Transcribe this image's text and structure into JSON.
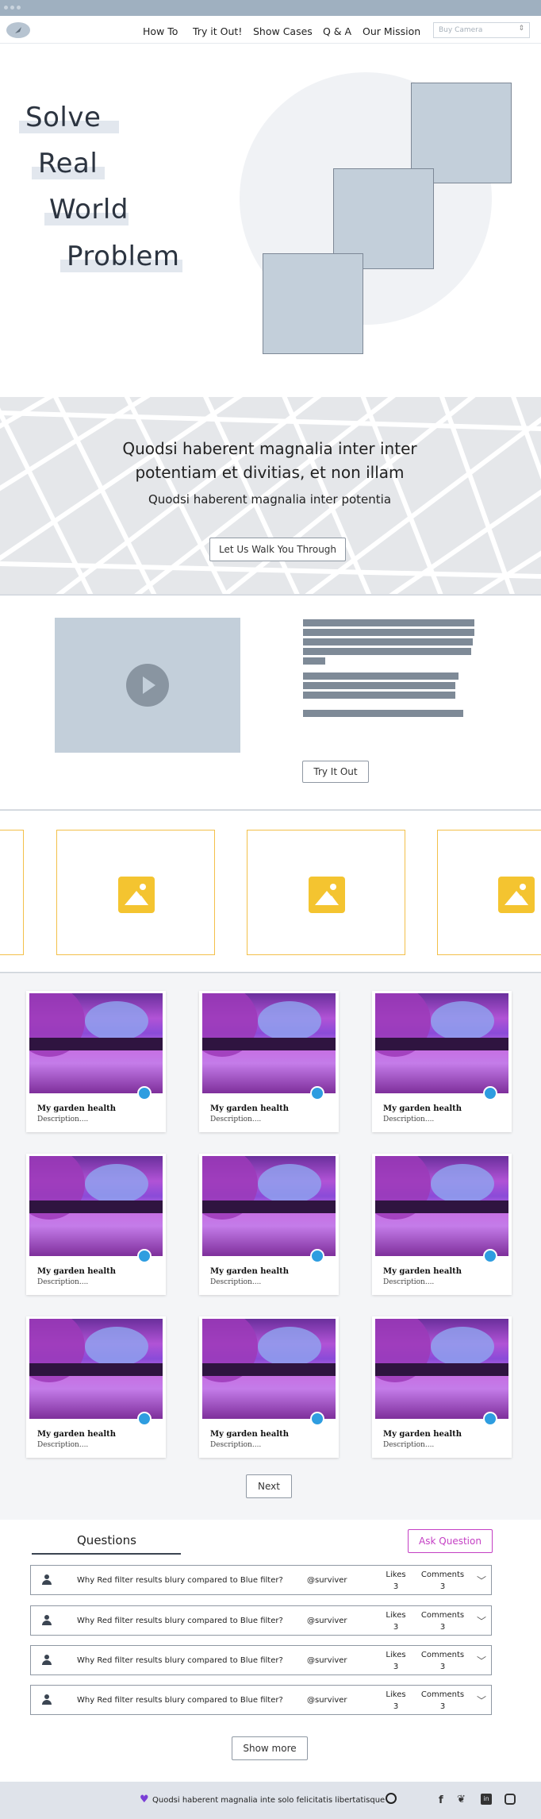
{
  "nav": {
    "links": [
      "How To",
      "Try it Out!",
      "Show Cases",
      "Q & A",
      "Our Mission"
    ],
    "select_value": "Buy Camera",
    "select_arrow": "⇕"
  },
  "hero": {
    "words": [
      "Solve",
      "Real",
      "World",
      "Problem"
    ]
  },
  "banner": {
    "headline": "Quodsi haberent magnalia inter inter potentiam et divitias, et non illam",
    "subline": "Quodsi haberent magnalia inter potentia",
    "button": "Let Us Walk You Through"
  },
  "feature": {
    "button": "Try It Out"
  },
  "gallery": {
    "cards": [
      {
        "title": "My garden health",
        "desc": "Description...."
      },
      {
        "title": "My garden health",
        "desc": "Description...."
      },
      {
        "title": "My garden health",
        "desc": "Description...."
      },
      {
        "title": "My garden health",
        "desc": "Description...."
      },
      {
        "title": "My garden health",
        "desc": "Description...."
      },
      {
        "title": "My garden health",
        "desc": "Description...."
      },
      {
        "title": "My garden health",
        "desc": "Description...."
      },
      {
        "title": "My garden health",
        "desc": "Description...."
      },
      {
        "title": "My garden health",
        "desc": "Description...."
      }
    ],
    "next": "Next"
  },
  "questions": {
    "tab": "Questions",
    "ask": "Ask Question",
    "items": [
      {
        "q": "Why Red filter results blury compared to Blue filter?",
        "user": "@surviver",
        "likes_label": "Likes",
        "likes": "3",
        "comments_label": "Comments",
        "comments": "3"
      },
      {
        "q": "Why Red filter results blury compared to Blue filter?",
        "user": "@surviver",
        "likes_label": "Likes",
        "likes": "3",
        "comments_label": "Comments",
        "comments": "3"
      },
      {
        "q": "Why Red filter results blury compared to Blue filter?",
        "user": "@surviver",
        "likes_label": "Likes",
        "likes": "3",
        "comments_label": "Comments",
        "comments": "3"
      },
      {
        "q": "Why Red filter results blury compared to Blue filter?",
        "user": "@surviver",
        "likes_label": "Likes",
        "likes": "3",
        "comments_label": "Comments",
        "comments": "3"
      }
    ],
    "more": "Show more"
  },
  "footer": {
    "text": "Quodsi haberent magnalia inte solo felicitatis libertatisque",
    "icons": [
      "heart-icon",
      "github-icon",
      "facebook-icon",
      "twitter-icon",
      "linkedin-icon",
      "instagram-icon"
    ]
  },
  "colors": {
    "accent": "#f3c04a",
    "ask": "#c43fc4",
    "placeholder": "#c3cfda",
    "heart": "#7b3fd6"
  }
}
